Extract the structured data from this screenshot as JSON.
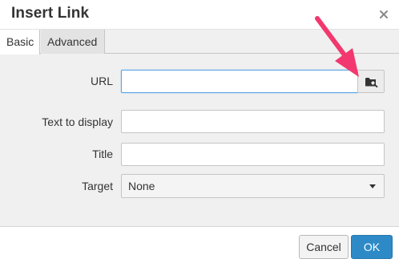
{
  "dialog": {
    "title": "Insert Link",
    "close_icon": "close-icon"
  },
  "tabs": [
    {
      "label": "Basic",
      "active": true
    },
    {
      "label": "Advanced",
      "active": false
    }
  ],
  "form": {
    "url": {
      "label": "URL",
      "value": "",
      "focused": true,
      "browse_icon": "folder-search-icon"
    },
    "text_to_display": {
      "label": "Text to display",
      "value": ""
    },
    "title": {
      "label": "Title",
      "value": ""
    },
    "target": {
      "label": "Target",
      "selected": "None"
    }
  },
  "footer": {
    "cancel_label": "Cancel",
    "ok_label": "OK"
  },
  "annotation": {
    "icon": "pointer-arrow-icon",
    "color": "#f2386f"
  },
  "colors": {
    "accent": "#2d8ac7",
    "focus_border": "#59a5e5",
    "panel_bg": "#f0f0f0"
  }
}
